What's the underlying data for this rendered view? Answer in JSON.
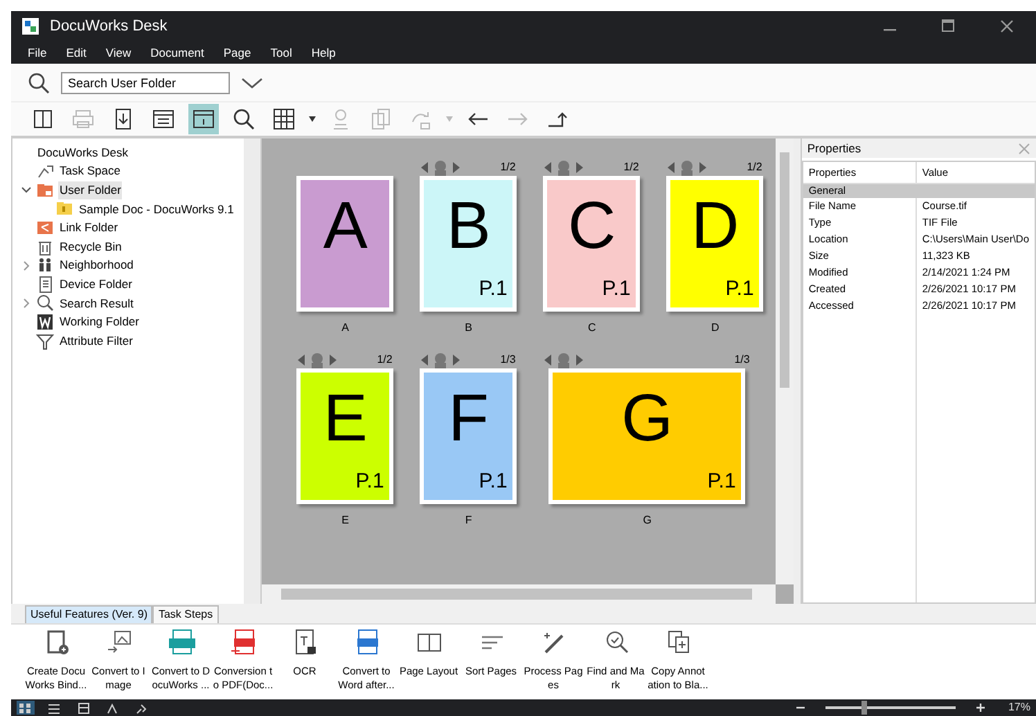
{
  "window": {
    "title": "DocuWorks Desk"
  },
  "menu": [
    "File",
    "Edit",
    "View",
    "Document",
    "Page",
    "Tool",
    "Help"
  ],
  "search": {
    "value": "Search User Folder"
  },
  "toolbar": [
    {
      "kind": "split",
      "disabled": false,
      "selected": false
    },
    {
      "kind": "print",
      "disabled": true,
      "selected": false
    },
    {
      "kind": "import",
      "disabled": false,
      "selected": false
    },
    {
      "kind": "viewer",
      "disabled": false,
      "selected": false
    },
    {
      "kind": "info",
      "disabled": false,
      "selected": true
    },
    {
      "kind": "search",
      "disabled": false,
      "selected": false
    },
    {
      "kind": "grid",
      "disabled": false,
      "selected": false
    },
    {
      "kind": "stamp",
      "disabled": true,
      "selected": false
    },
    {
      "kind": "copy",
      "disabled": true,
      "selected": false
    },
    {
      "kind": "convert",
      "disabled": true,
      "selected": false
    },
    {
      "kind": "back",
      "disabled": false,
      "selected": false
    },
    {
      "kind": "forward",
      "disabled": true,
      "selected": false
    },
    {
      "kind": "up",
      "disabled": false,
      "selected": false
    }
  ],
  "tree": {
    "root": "DocuWorks Desk",
    "items": [
      {
        "label": "Task Space",
        "selected": false
      },
      {
        "label": "User Folder",
        "expanded": true,
        "selected": true,
        "children": [
          {
            "label": "Sample Doc - DocuWorks 9.1",
            "selected": false
          }
        ]
      },
      {
        "label": "Link Folder",
        "selected": false
      },
      {
        "label": "Recycle Bin",
        "selected": false
      },
      {
        "label": "Neighborhood",
        "expanded": false,
        "selected": false
      },
      {
        "label": "Device Folder",
        "selected": false
      },
      {
        "label": "Search Result",
        "expanded": false,
        "selected": false
      },
      {
        "label": "Working Folder",
        "selected": false
      },
      {
        "label": "Attribute Filter",
        "selected": false
      }
    ]
  },
  "documents": [
    {
      "letter": "A",
      "caption": "A",
      "color": "#c99bd0",
      "kind": "single"
    },
    {
      "letter": "B",
      "caption": "B",
      "color": "#ccf6f8",
      "kind": "bundle",
      "pages": "1/2",
      "page_label": "P.1"
    },
    {
      "letter": "C",
      "caption": "C",
      "color": "#f9c9c9",
      "kind": "bundle",
      "pages": "1/2",
      "page_label": "P.1"
    },
    {
      "letter": "D",
      "caption": "D",
      "color": "#ffff00",
      "kind": "bundle",
      "pages": "1/2",
      "page_label": "P.1"
    },
    {
      "letter": "E",
      "caption": "E",
      "color": "#ccff00",
      "kind": "bundle",
      "pages": "1/2",
      "page_label": "P.1"
    },
    {
      "letter": "F",
      "caption": "F",
      "color": "#99c8f5",
      "kind": "bundle",
      "pages": "1/3",
      "page_label": "P.1"
    },
    {
      "letter": "G",
      "caption": "G",
      "color": "#ffcc00",
      "kind": "wide",
      "pages": "1/3",
      "page_label": "P.1"
    }
  ],
  "properties": {
    "title": "Properties",
    "columns": [
      "Properties",
      "Value"
    ],
    "group": "General",
    "rows": [
      [
        "File Name",
        "Course.tif"
      ],
      [
        "Type",
        "TIF File"
      ],
      [
        "Location",
        "C:\\Users\\Main User\\Do"
      ],
      [
        "Size",
        "11,323 KB"
      ],
      [
        "Modified",
        "2/14/2021 1:24 PM"
      ],
      [
        "Created",
        "2/26/2021 10:17 PM"
      ],
      [
        "Accessed",
        "2/26/2021 10:17 PM"
      ]
    ]
  },
  "feature_tabs": [
    {
      "label": "Useful Features (Ver. 9)",
      "selected": true
    },
    {
      "label": "Task Steps",
      "selected": false
    }
  ],
  "features": [
    {
      "label": [
        "Create Docu",
        "Works Bind..."
      ]
    },
    {
      "label": [
        "Convert to I",
        "mage"
      ]
    },
    {
      "label": [
        "Convert to D",
        "ocuWorks ..."
      ]
    },
    {
      "label": [
        "Conversion t",
        "o PDF(Doc..."
      ]
    },
    {
      "label": [
        "OCR"
      ]
    },
    {
      "label": [
        "Convert to",
        "Word after..."
      ]
    },
    {
      "label": [
        "Page Layout"
      ]
    },
    {
      "label": [
        "Sort Pages"
      ]
    },
    {
      "label": [
        "Process Pag",
        "es"
      ]
    },
    {
      "label": [
        "Find and Ma",
        "rk"
      ]
    },
    {
      "label": [
        "Copy Annot",
        "ation to Bla..."
      ]
    }
  ],
  "status_bar": {
    "views": [
      {
        "selected": true
      },
      {
        "selected": false
      },
      {
        "selected": false
      },
      {
        "selected": false
      },
      {
        "selected": false
      }
    ],
    "zoom": {
      "level": 0.3,
      "reading": "17%"
    }
  }
}
